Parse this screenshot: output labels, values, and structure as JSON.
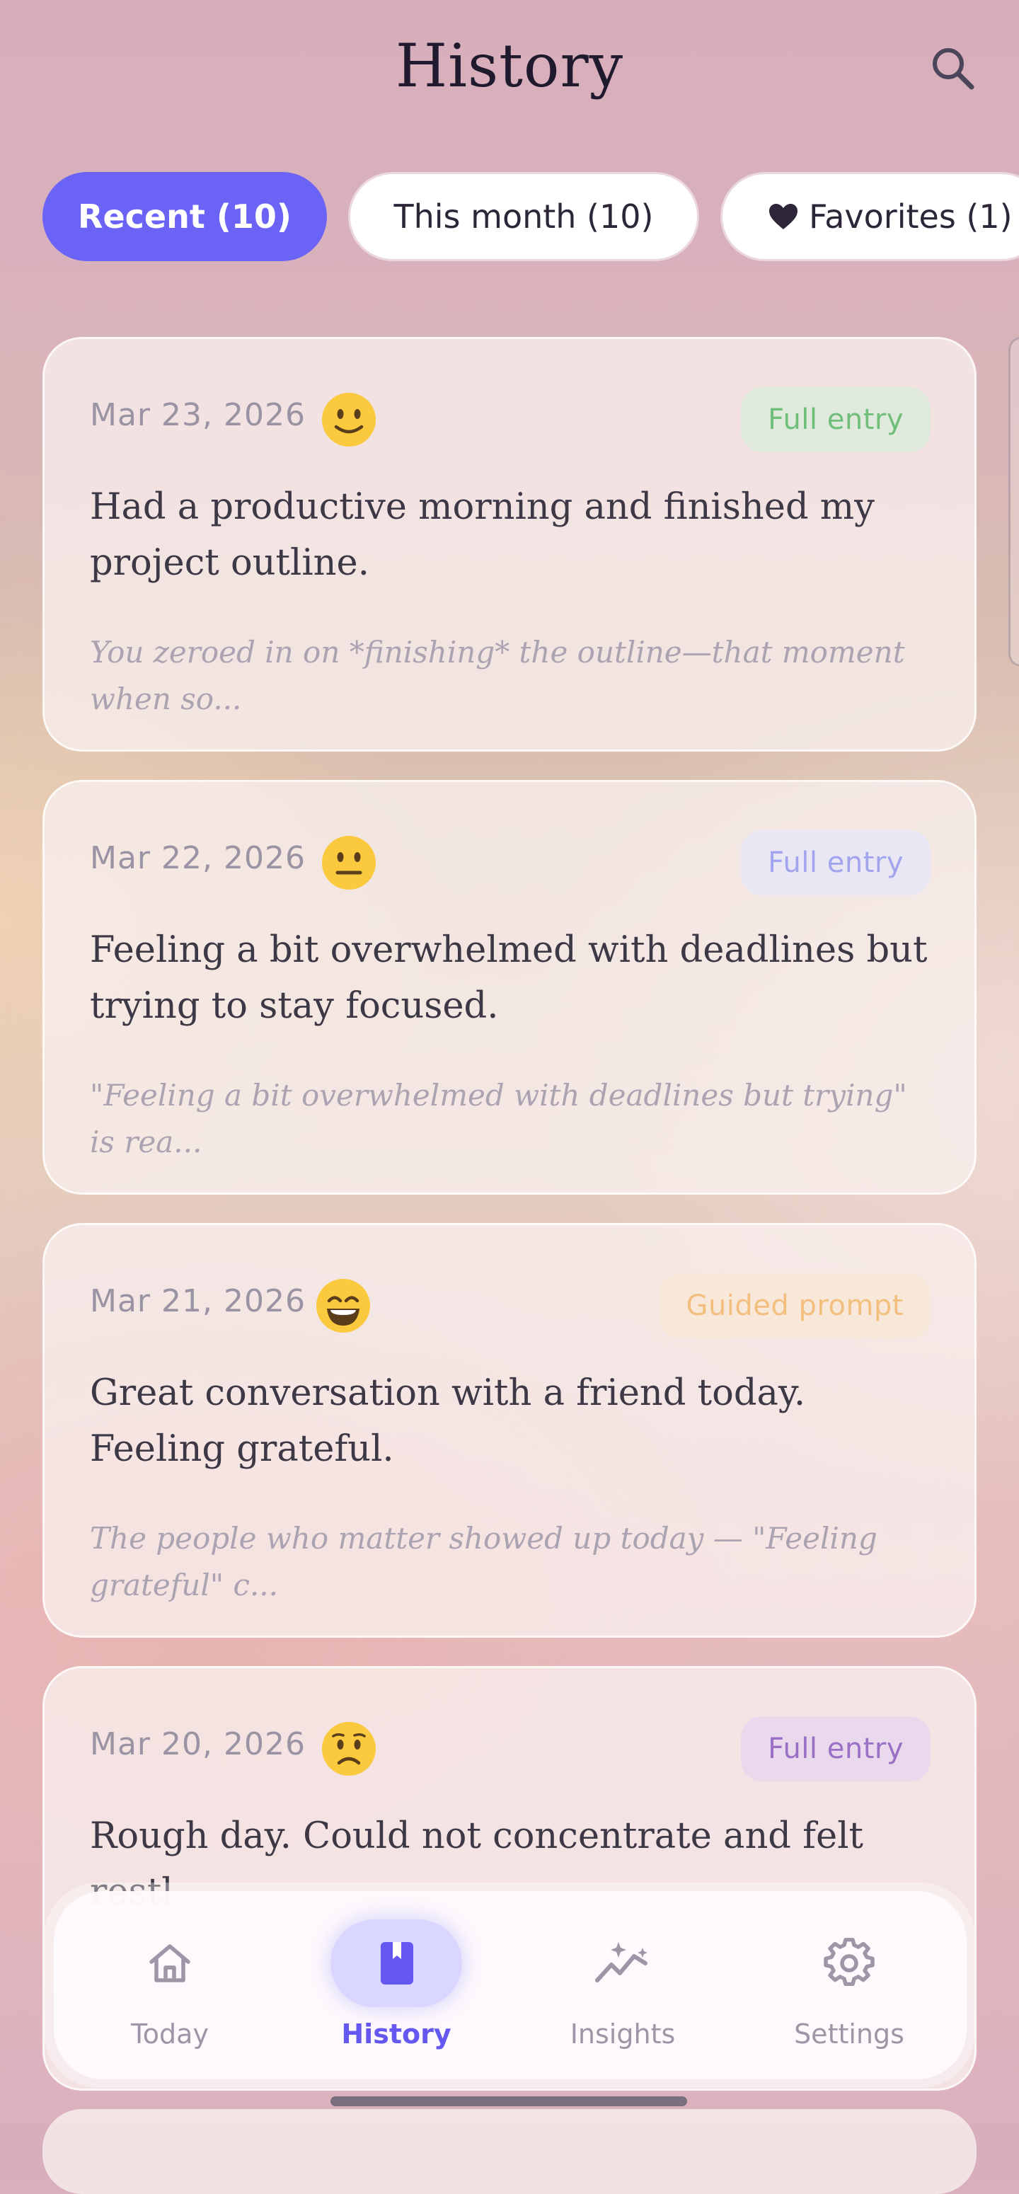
{
  "header": {
    "title": "History",
    "search_icon": "search-icon"
  },
  "filters": [
    {
      "label": "Recent (10)",
      "active": true
    },
    {
      "label": "This month (10)",
      "active": false
    },
    {
      "label": "Favorites (1)",
      "active": false,
      "icon": "heart-icon"
    }
  ],
  "entries": [
    {
      "date": "Mar 23, 2026",
      "mood_icon": "slight-smile-emoji-icon",
      "badge": "Full entry",
      "badge_bg": "#dfe9dc",
      "badge_color": "#6fbf7a",
      "text": "Had a productive morning and finished my project outline.",
      "excerpt": "You zeroed in on *finishing* the outline—that moment when so..."
    },
    {
      "date": "Mar 22, 2026",
      "mood_icon": "neutral-face-emoji-icon",
      "badge": "Full entry",
      "badge_bg": "#e8e7f3",
      "badge_color": "#a2a4ee",
      "text": "Feeling a bit overwhelmed with deadlines but trying to stay focused.",
      "excerpt": "\"Feeling a bit overwhelmed with deadlines but trying\" is rea..."
    },
    {
      "date": "Mar 21, 2026",
      "mood_icon": "grinning-face-emoji-icon",
      "badge": "Guided prompt",
      "badge_bg": "#f8e8da",
      "badge_color": "#f3bf7e",
      "text": "Great conversation with a friend today. Feeling grateful.",
      "excerpt": "The people who matter showed up today — \"Feeling grateful\" c..."
    },
    {
      "date": "Mar 20, 2026",
      "mood_icon": "worried-face-emoji-icon",
      "badge": "Full entry",
      "badge_bg": "#ead9ec",
      "badge_color": "#9a6fc6",
      "text": "Rough day. Could not concentrate and felt restl",
      "excerpt": ""
    }
  ],
  "nav": [
    {
      "label": "Today",
      "icon": "home-icon",
      "active": false
    },
    {
      "label": "History",
      "icon": "book-icon",
      "active": true
    },
    {
      "label": "Insights",
      "icon": "sparkle-chart-icon",
      "active": false
    },
    {
      "label": "Settings",
      "icon": "gear-icon",
      "active": false
    }
  ],
  "colors": {
    "accent": "#6b63f5",
    "nav_active": "#6558f0"
  }
}
